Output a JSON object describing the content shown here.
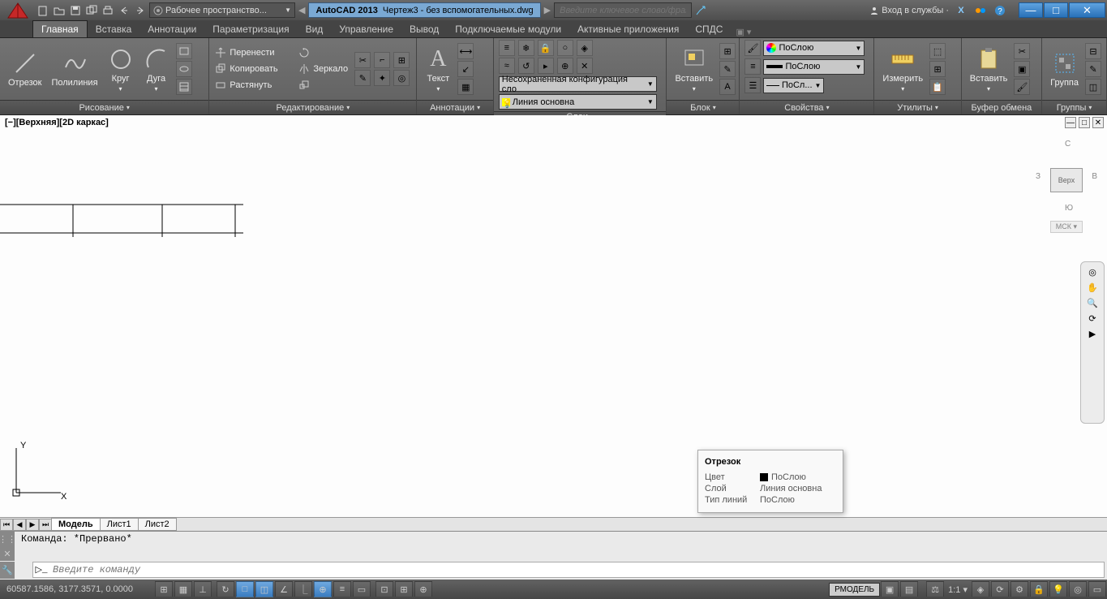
{
  "titlebar": {
    "workspace": "Рабочее пространство...",
    "app": "AutoCAD 2013",
    "doc": "Чертеж3 - без вспомогательных.dwg",
    "search_placeholder": "Введите ключевое слово/фразу",
    "login": "Вход в службы"
  },
  "tabs": [
    "Главная",
    "Вставка",
    "Аннотации",
    "Параметризация",
    "Вид",
    "Управление",
    "Вывод",
    "Подключаемые модули",
    "Активные приложения",
    "СПДС"
  ],
  "active_tab": 0,
  "ribbon": {
    "draw": {
      "label": "Рисование",
      "line": "Отрезок",
      "polyline": "Полилиния",
      "circle": "Круг",
      "arc": "Дуга"
    },
    "modify": {
      "label": "Редактирование",
      "move": "Перенести",
      "copy": "Копировать",
      "stretch": "Растянуть",
      "rotate": "",
      "mirror": "Зеркало"
    },
    "annot": {
      "label": "Аннотации",
      "text": "Текст"
    },
    "layers": {
      "label": "Слои",
      "unsaved": "Несохраненная конфигурация сло",
      "current": "Линия основна"
    },
    "block": {
      "label": "Блок",
      "insert": "Вставить"
    },
    "props": {
      "label": "Свойства",
      "color": "ПоСлою",
      "ltype": "ПоСлою",
      "lweight": "ПоСл..."
    },
    "util": {
      "label": "Утилиты",
      "measure": "Измерить"
    },
    "clip": {
      "label": "Буфер обмена",
      "paste": "Вставить"
    },
    "group": {
      "label": "Группы",
      "grp": "Группа"
    }
  },
  "viewport": {
    "label": "[−][Верхняя][2D каркас]",
    "cube": "Верх",
    "compass": {
      "n": "С",
      "e": "В",
      "s": "Ю",
      "w": "З"
    },
    "wcs": "МСК"
  },
  "tooltip": {
    "title": "Отрезок",
    "rows": [
      {
        "k": "Цвет",
        "v": "ПоСлою",
        "swatch": true
      },
      {
        "k": "Слой",
        "v": "Линия основна"
      },
      {
        "k": "Тип линий",
        "v": "ПоСлою"
      }
    ]
  },
  "model_tabs": [
    "Модель",
    "Лист1",
    "Лист2"
  ],
  "command": {
    "history": "Команда:  *Прервано*",
    "placeholder": "Введите команду"
  },
  "status": {
    "coords": "60587.1586, 3177.3571, 0.0000",
    "model": "РМОДЕЛЬ",
    "scale": "1:1"
  }
}
